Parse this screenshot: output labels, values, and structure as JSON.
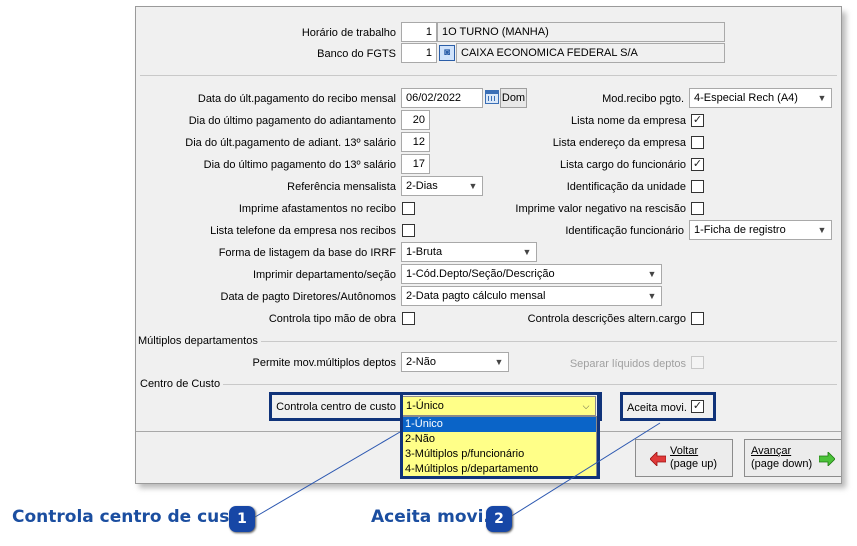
{
  "header": {
    "horario": {
      "label": "Horário de trabalho",
      "code": "1",
      "value": "1O TURNO (MANHA)"
    },
    "fgts": {
      "label": "Banco do FGTS",
      "code": "1",
      "value": "CAIXA ECONOMICA FEDERAL S/A"
    }
  },
  "left": {
    "data_pag": {
      "label": "Data do últ.pagamento do recibo mensal",
      "value": "06/02/2022",
      "weekday": "Dom"
    },
    "dia_adiant": {
      "label": "Dia do último pagamento do adiantamento",
      "value": "20"
    },
    "dia_adiant13": {
      "label": "Dia do últ.pagamento de adiant. 13º salário",
      "value": "12"
    },
    "dia_13": {
      "label": "Dia do último pagamento do 13º salário",
      "value": "17"
    },
    "ref_mensalista": {
      "label": "Referência mensalista",
      "value": "2-Dias"
    },
    "imprime_afast": {
      "label": "Imprime afastamentos no recibo",
      "checked": false
    },
    "lista_tel": {
      "label": "Lista telefone da empresa nos recibos",
      "checked": false
    },
    "forma_irrf": {
      "label": "Forma de listagem da base do IRRF",
      "value": "1-Bruta"
    },
    "imprimir_depto": {
      "label": "Imprimir departamento/seção",
      "value": "1-Cód.Depto/Seção/Descrição"
    },
    "data_diretores": {
      "label": "Data de pagto Diretores/Autônomos",
      "value": "2-Data pagto cálculo mensal"
    },
    "controla_mao": {
      "label": "Controla tipo mão de obra",
      "checked": false
    }
  },
  "right": {
    "mod_recibo": {
      "label": "Mod.recibo pgto.",
      "value": "4-Especial Rech (A4)"
    },
    "lista_nome": {
      "label": "Lista nome da empresa",
      "checked": true
    },
    "lista_end": {
      "label": "Lista endereço da empresa",
      "checked": false
    },
    "lista_cargo": {
      "label": "Lista cargo do funcionário",
      "checked": true
    },
    "ident_unidade": {
      "label": "Identificação da unidade",
      "checked": false
    },
    "imprime_neg": {
      "label": "Imprime valor negativo na rescisão",
      "checked": false
    },
    "ident_func": {
      "label": "Identificação funcionário",
      "value": "1-Ficha de registro"
    },
    "controla_desc": {
      "label": "Controla descrições altern.cargo",
      "checked": false
    }
  },
  "multi": {
    "title": "Múltiplos departamentos",
    "permite": {
      "label": "Permite mov.múltiplos deptos",
      "value": "2-Não"
    },
    "separar": {
      "label": "Separar líquidos deptos",
      "checked": false
    }
  },
  "custo": {
    "title": "Centro de Custo",
    "controla": {
      "label": "Controla centro de custo",
      "value": "1-Único"
    },
    "options": [
      "1-Único",
      "2-Não",
      "3-Múltiplos p/funcionário",
      "4-Múltiplos p/departamento"
    ],
    "aceita": {
      "label": "Aceita movi.",
      "checked": true
    }
  },
  "nav": {
    "voltar": {
      "line1": "Voltar",
      "line2": "(page up)"
    },
    "avancar": {
      "line1": "Avançar",
      "line2": "(page down)"
    }
  },
  "callouts": {
    "c1": {
      "text": "Controla centro de custo",
      "num": "1"
    },
    "c2": {
      "text": "Aceita movi.",
      "num": "2"
    }
  },
  "colors": {
    "highlight": "#10337a",
    "dropdown_bg": "#ffff88",
    "selection": "#0a64c8",
    "callout": "#1b4ea0"
  }
}
